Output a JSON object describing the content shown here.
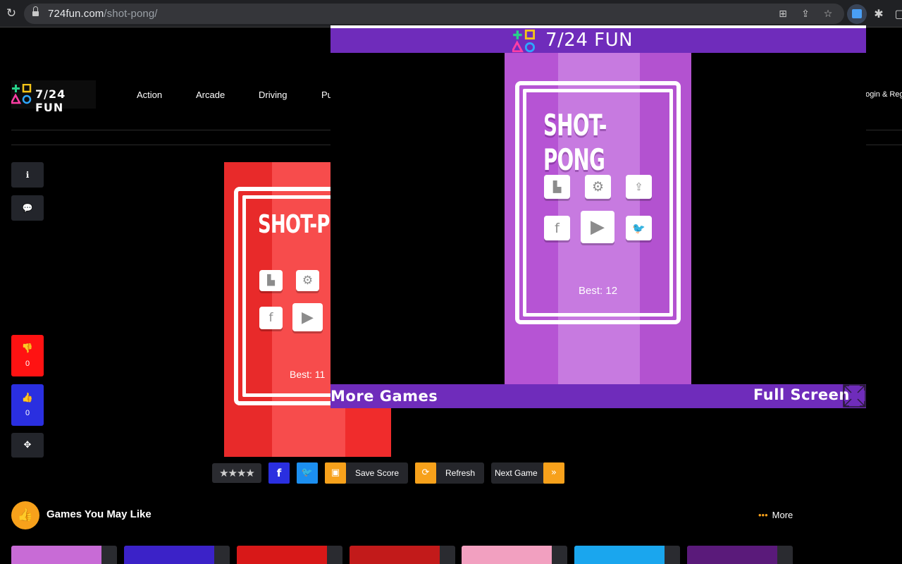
{
  "browser": {
    "url_domain": "724fun.com",
    "url_path": "/shot-pong/"
  },
  "site": {
    "logo_text": "7/24 FUN",
    "nav": [
      "Action",
      "Arcade",
      "Driving",
      "Pu"
    ],
    "login": "Login & Reg"
  },
  "rail": {
    "dislike_count": "0",
    "like_count": "0"
  },
  "bg_game": {
    "title": "SHOT-PO",
    "best": "Best: 11"
  },
  "modal": {
    "logo_text": "7/24 FUN",
    "game_title": "SHOT-PONG",
    "best": "Best: 12",
    "more_games": "More Games",
    "full_screen": "Full Screen"
  },
  "actions": {
    "stars": "★★★★",
    "save_score": "Save Score",
    "refresh": "Refresh",
    "next_game": "Next Game"
  },
  "section": {
    "title": "Games You May Like",
    "more": "More"
  },
  "colors": {
    "accent": "#f7a11b",
    "modal_purple": "#6f2cbb",
    "game_purple": "#b45ad2",
    "game_red": "#e82a2a",
    "facebook": "#2a2fe0",
    "twitter": "#1c8ff0"
  }
}
